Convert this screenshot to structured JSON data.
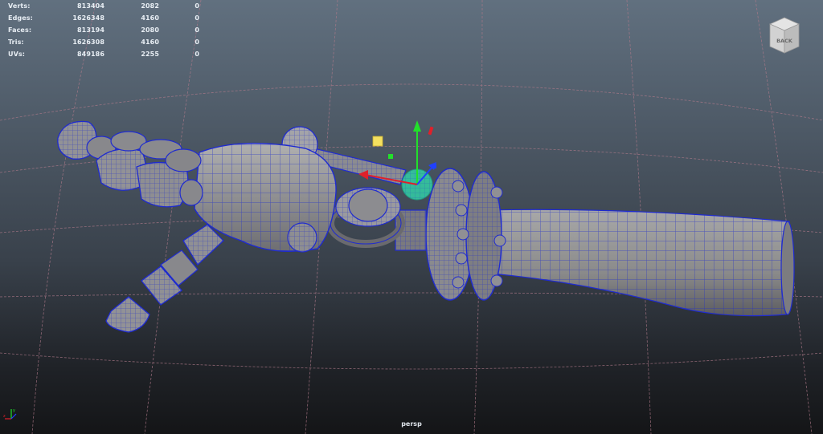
{
  "hud": {
    "rows": [
      {
        "label": "Verts:",
        "v1": "813404",
        "v2": "2082",
        "v3": "0"
      },
      {
        "label": "Edges:",
        "v1": "1626348",
        "v2": "4160",
        "v3": "0"
      },
      {
        "label": "Faces:",
        "v1": "813194",
        "v2": "2080",
        "v3": "0"
      },
      {
        "label": "Tris:",
        "v1": "1626308",
        "v2": "4160",
        "v3": "0"
      },
      {
        "label": "UVs:",
        "v1": "849186",
        "v2": "2255",
        "v3": "0"
      }
    ]
  },
  "viewcube": {
    "face_label": "BACK"
  },
  "camera": {
    "name": "persp"
  },
  "colors": {
    "wireframe": "#1f2bd0",
    "mesh_fill": "#8e8e8e",
    "grid": "#b07a8a",
    "manip_x": "#e0202a",
    "manip_y": "#22e02a",
    "manip_z": "#2040ff",
    "pivot_sphere": "#30e0b0",
    "manip_square": "#f4e060"
  },
  "icons": {
    "viewcube": "viewcube-icon",
    "axis": "world-axis-icon",
    "manipulator": "move-manipulator-icon"
  }
}
